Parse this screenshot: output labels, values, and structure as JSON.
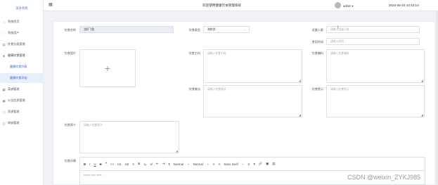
{
  "sidebar": {
    "title": "美食系统",
    "items": [
      {
        "label": "系统首页",
        "icon": "home-icon"
      },
      {
        "label": "系统用户",
        "icon": "user-icon"
      },
      {
        "label": "饮食分类管理",
        "icon": "list-icon"
      },
      {
        "label": "健康饮食管理",
        "icon": "food-icon"
      },
      {
        "label": "健康饮食列表",
        "icon": ""
      },
      {
        "label": "健康饮食添加",
        "icon": ""
      },
      {
        "label": "菜谱管理",
        "icon": "book-icon"
      },
      {
        "label": "公告信息管理",
        "icon": "notice-icon"
      },
      {
        "label": "资源管理",
        "icon": "folder-icon"
      },
      {
        "label": "商城管理",
        "icon": "shop-icon"
      }
    ]
  },
  "topbar": {
    "title": "欢迎使用健康饮食管理系统",
    "username": "admin ▾",
    "datetime": "2024-05-15 10:43:10"
  },
  "form": {
    "name_label": "饮食名称",
    "name_value": "龙虾飞鱼",
    "category_label": "饮食类型",
    "category_value": "海鲜类",
    "amount_label": "适量人群",
    "amount_placeholder": "请输入适量人群",
    "time_label": "食用时间",
    "time_placeholder": "请输入时间",
    "image_label": "饮食图片",
    "ingredients_label": "饮食主料",
    "ingredients_placeholder": "请输入饮食主料",
    "sub_ingredients_label": "饮食辅料",
    "sub_ingredients_placeholder": "请输入饮食辅料",
    "steps_label": "饮食做法",
    "steps_placeholder": "请输入饮食做法",
    "tips_label": "饮食提示",
    "tips_placeholder": "请输入饮食提示",
    "intro_label": "饮食简介",
    "intro_placeholder": "请输入饮食简介",
    "detail_label": "饮食详情"
  },
  "editor": {
    "toolbar": [
      "B",
      "I",
      "U",
      "S",
      "❝",
      "<>",
      "H1",
      "H2",
      "≡",
      "≣",
      "x₂",
      "x²",
      "⇤",
      "⇥",
      "¶",
      "Normal",
      "⌄",
      "Normal",
      "⌄",
      "A",
      "Ā",
      "Sans Serif",
      "⌄",
      "≡",
      "T̸",
      "🔗",
      "▣",
      "▤"
    ],
    "placeholder": "Insert text here ..."
  },
  "watermark": "CSDN @weixin_ZYKJ985"
}
